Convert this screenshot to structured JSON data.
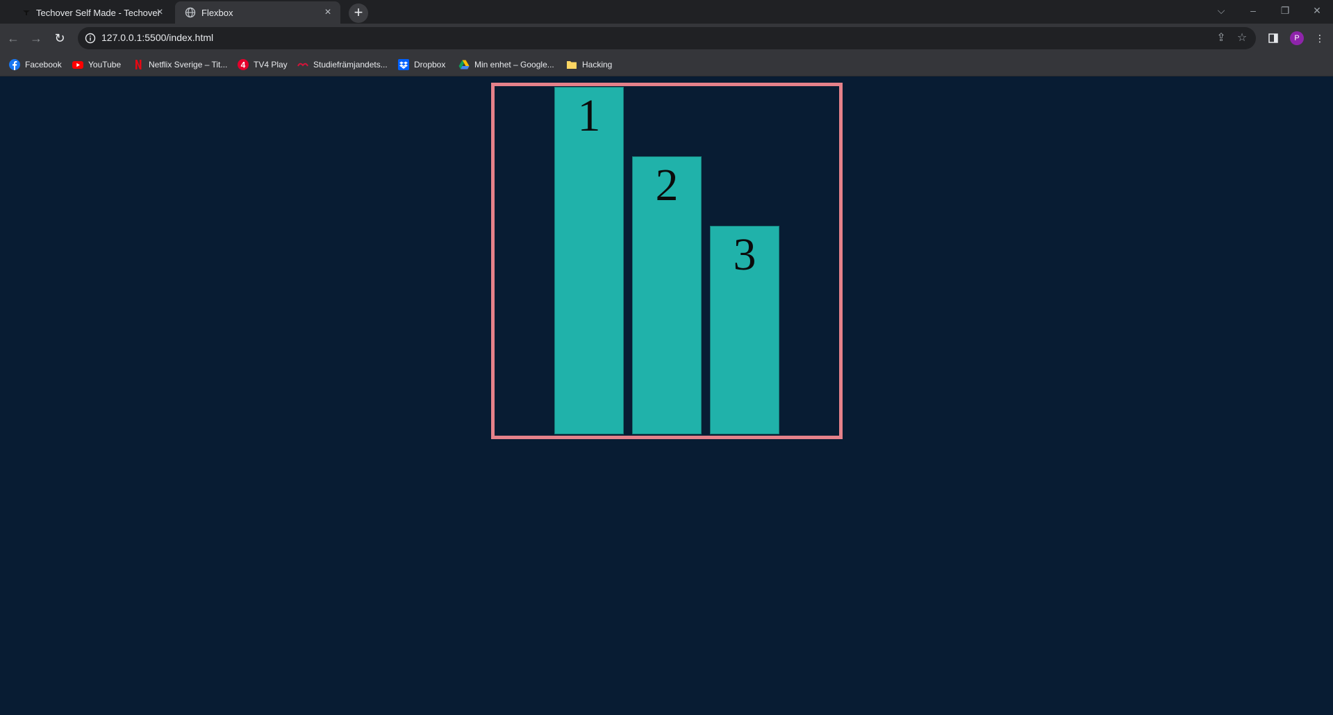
{
  "tabs": [
    {
      "title": "Techover Self Made - Techover",
      "active": false
    },
    {
      "title": "Flexbox",
      "active": true
    }
  ],
  "window_controls": {
    "list": "⌵",
    "minimize": "–",
    "restore": "❐",
    "close": "✕"
  },
  "address_bar": {
    "url": "127.0.0.1:5500/index.html"
  },
  "profile": {
    "initial": "P",
    "color": "#8e24aa"
  },
  "bookmarks": [
    {
      "label": "Facebook",
      "icon": "facebook-icon"
    },
    {
      "label": "YouTube",
      "icon": "youtube-icon"
    },
    {
      "label": "Netflix Sverige – Tit...",
      "icon": "netflix-icon"
    },
    {
      "label": "TV4 Play",
      "icon": "tv4-icon"
    },
    {
      "label": "Studiefrämjandets...",
      "icon": "studieframjandet-icon"
    },
    {
      "label": "Dropbox",
      "icon": "dropbox-icon"
    },
    {
      "label": "Min enhet – Google...",
      "icon": "google-drive-icon"
    },
    {
      "label": "Hacking",
      "icon": "folder-icon"
    }
  ],
  "page": {
    "background": "#081c33",
    "container_border_color": "#e5818a",
    "box_color": "#20b2aa",
    "boxes": [
      {
        "label": "1"
      },
      {
        "label": "2"
      },
      {
        "label": "3"
      }
    ]
  }
}
